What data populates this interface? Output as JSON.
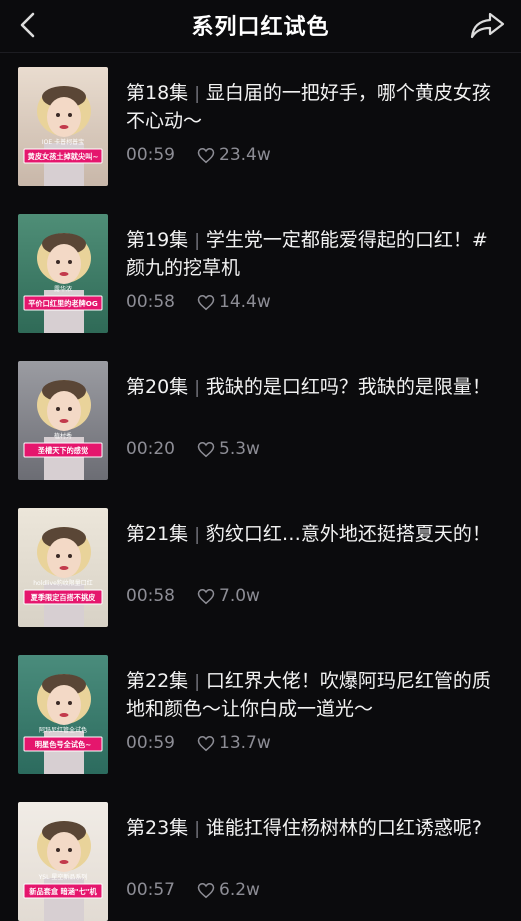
{
  "header": {
    "title": "系列口红试色",
    "back_icon": "chevron-left-icon",
    "share_icon": "share-icon"
  },
  "colors": {
    "background": "#0b0b0d",
    "text_primary": "#f2f2f2",
    "text_secondary": "#8d8d95",
    "thumb_tag": "#e5166d"
  },
  "episodes": [
    {
      "ep": "第18集",
      "title": "显白届的一把好手，哪个黄皮女孩不心动～",
      "duration": "00:59",
      "likes": "23.4w",
      "thumb_caption": "黄皮女孩土掉就尖叫~",
      "thumb_small": "IOE 卡普柯普宝"
    },
    {
      "ep": "第19集",
      "title": "学生党一定都能爱得起的口红！#颜九的挖草机",
      "duration": "00:58",
      "likes": "14.4w",
      "thumb_caption": "平价口红里的老牌OG",
      "thumb_small": "露华浓"
    },
    {
      "ep": "第20集",
      "title": "我缺的是口红吗？我缺的是限量！",
      "duration": "00:20",
      "likes": "5.3w",
      "thumb_caption": "圣槽天下的感觉",
      "thumb_small": "植村秀"
    },
    {
      "ep": "第21集",
      "title": "豹纹口红…意外地还挺搭夏天的！",
      "duration": "00:58",
      "likes": "7.0w",
      "thumb_caption": "夏季限定百搭不挑皮",
      "thumb_small": "holdlive豹纹限量口红"
    },
    {
      "ep": "第22集",
      "title": "口红界大佬！吹爆阿玛尼红管的质地和颜色～让你白成一道光～",
      "duration": "00:59",
      "likes": "13.7w",
      "thumb_caption": "明星色号全试色~",
      "thumb_small": "阿玛尼红管全试色"
    },
    {
      "ep": "第23集",
      "title": "谁能扛得住杨树林的口红诱惑呢?",
      "duration": "00:57",
      "likes": "6.2w",
      "thumb_caption": "新品套盒 暗涵\"七\"机",
      "thumb_small": "YSL 星空新品系列"
    }
  ]
}
